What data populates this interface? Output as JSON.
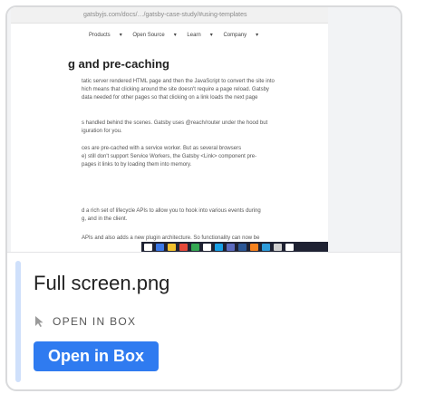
{
  "card": {
    "file_name": "Full screen.png",
    "open_link_label": "OPEN IN BOX",
    "open_button_label": "Open in Box",
    "accent_color": "#2f7bf0"
  },
  "preview": {
    "url_text": "gatsbyjs.com/docs/…/gatsby-case-study/#using-templates",
    "nav": [
      "Products",
      "Open Source",
      "Learn",
      "Company"
    ],
    "headline": "g and pre-caching",
    "paragraphs": [
      [
        "tatic server rendered HTML page and then the JavaScript to convert the site into",
        "hich means that clicking around the site doesn't require a page reload. Gatsby",
        "data needed for other pages so that clicking on a link loads the next page"
      ],
      [
        "s handled behind the scenes. Gatsby uses @reach/router under the hood but",
        "iguration for you."
      ],
      [
        "ces are pre-cached with a service worker. But as several browsers",
        "e) still don't support Service Workers, the Gatsby <Link> component pre-",
        "pages it links to by loading them into memory."
      ],
      [
        "d a rich set of lifecycle APIs to allow you to hook into various events during",
        "g, and in the client."
      ],
      [
        "APIs and also adds a new plugin architecture. So functionality can now be"
      ]
    ]
  }
}
